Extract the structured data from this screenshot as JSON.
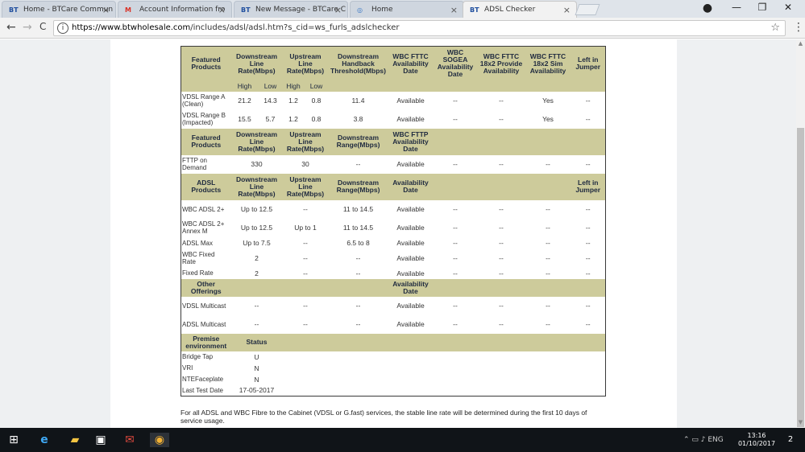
{
  "browser": {
    "tabs": [
      {
        "favicon": "BT",
        "title": "Home - BTCare Commun",
        "close": "×"
      },
      {
        "favicon": "M",
        "title": "Account Information fro",
        "close": "×"
      },
      {
        "favicon": "BT",
        "title": "New Message - BTCare C",
        "close": "×"
      },
      {
        "favicon": "◎",
        "title": "Home",
        "close": "×"
      },
      {
        "favicon": "BT",
        "title": "ADSL Checker",
        "close": "×"
      }
    ],
    "window_controls": {
      "minimize": "—",
      "maximize": "❐",
      "close": "✕"
    },
    "url_scheme_host": "https://www.btwholesale.com",
    "url_path": "/includes/adsl/adsl.htm?s_cid=ws_furls_adslchecker",
    "back": "←",
    "forward": "→",
    "reload": "C",
    "star": "☆",
    "menu": "⋮"
  },
  "headers": {
    "featured": "Featured Products",
    "down_rate": "Downstream Line Rate(Mbps)",
    "up_rate": "Upstream Line Rate(Mbps)",
    "handback": "Downstream Handback Threshold(Mbps)",
    "fttc_avail": "WBC FTTC Availability Date",
    "sogea": "WBC SOGEA Availability Date",
    "fttc_18x2": "WBC FTTC 18x2 Provide Availability",
    "fttc_sim": "WBC FTTC 18x2 Sim Availability",
    "left_jumper": "Left in Jumper",
    "high": "High",
    "low": "Low",
    "fttp_featured": "Featured Products",
    "down_range": "Downstream Range(Mbps)",
    "fttp_avail": "WBC FTTP Availability Date",
    "adsl_products": "ADSL Products",
    "availability": "Availability Date",
    "other": "Other Offerings",
    "premise": "Premise environment",
    "status": "Status"
  },
  "rows": {
    "vdsl_a": {
      "label": "VDSL Range A (Clean)",
      "v": [
        "21.2",
        "14.3",
        "1.2",
        "0.8",
        "11.4",
        "Available",
        "--",
        "--",
        "Yes",
        "--"
      ]
    },
    "vdsl_b": {
      "label": "VDSL Range B (Impacted)",
      "v": [
        "15.5",
        "5.7",
        "1.2",
        "0.8",
        "3.8",
        "Available",
        "--",
        "--",
        "Yes",
        "--"
      ]
    },
    "fttp": {
      "label": "FTTP on Demand",
      "v": [
        "330",
        "30",
        "--",
        "Available",
        "--",
        "--",
        "--",
        "--"
      ]
    },
    "adsl2": {
      "label": "WBC ADSL 2+",
      "v": [
        "Up to 12.5",
        "--",
        "11 to 14.5",
        "Available",
        "--",
        "--",
        "--",
        "--"
      ]
    },
    "adsl2m": {
      "label": "WBC ADSL 2+ Annex M",
      "v": [
        "Up to 12.5",
        "Up to 1",
        "11 to 14.5",
        "Available",
        "--",
        "--",
        "--",
        "--"
      ]
    },
    "adslmax": {
      "label": "ADSL Max",
      "v": [
        "Up to 7.5",
        "--",
        "6.5 to 8",
        "Available",
        "--",
        "--",
        "--",
        "--"
      ]
    },
    "wbcfixed": {
      "label": "WBC Fixed Rate",
      "v": [
        "2",
        "--",
        "--",
        "Available",
        "--",
        "--",
        "--",
        "--"
      ]
    },
    "fixed": {
      "label": "Fixed Rate",
      "v": [
        "2",
        "--",
        "--",
        "Available",
        "--",
        "--",
        "--",
        "--"
      ]
    },
    "vdslmc": {
      "label": "VDSL Multicast",
      "v": [
        "--",
        "--",
        "--",
        "Available",
        "--",
        "--",
        "--",
        "--"
      ]
    },
    "adslmc": {
      "label": "ADSL Multicast",
      "v": [
        "--",
        "--",
        "--",
        "Available",
        "--",
        "--",
        "--",
        "--"
      ]
    },
    "bridge": {
      "label": "Bridge Tap",
      "v": [
        "U"
      ]
    },
    "vri": {
      "label": "VRI",
      "v": [
        "N"
      ]
    },
    "nte": {
      "label": "NTEFaceplate",
      "v": [
        "N"
      ]
    },
    "last": {
      "label": "Last Test Date",
      "v": [
        "17-05-2017"
      ]
    }
  },
  "footnote": "For all ADSL and WBC Fibre to the Cabinet (VDSL or G.fast) services, the stable line rate will be determined during the first 10 days of service usage.",
  "taskbar": {
    "time": "13:16",
    "date": "01/10/2017",
    "notifications": "2",
    "tray": "⌃  ▭  ♪  ENG"
  },
  "colors": {
    "header_bg": "#cdcb9b",
    "border": "#3a3a3a"
  }
}
